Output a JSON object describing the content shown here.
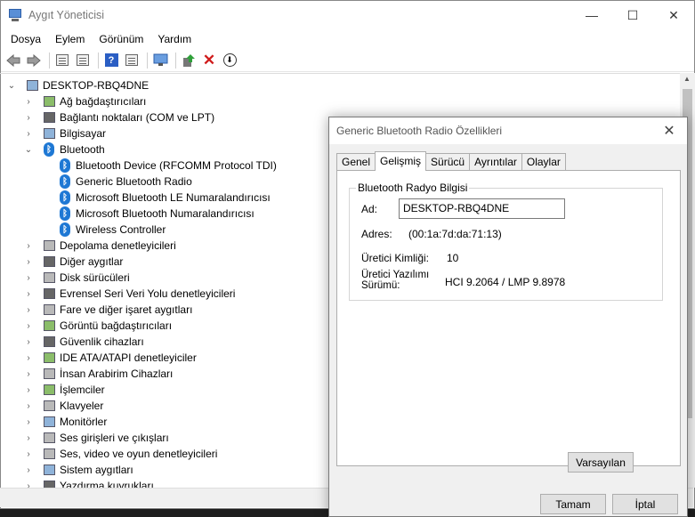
{
  "window": {
    "title": "Aygıt Yöneticisi",
    "controls": {
      "minimize": "—",
      "maximize": "☐",
      "close": "✕"
    }
  },
  "menu": [
    "Dosya",
    "Eylem",
    "Görünüm",
    "Yardım"
  ],
  "tree": {
    "root": "DESKTOP-RBQ4DNE",
    "categories_before": [
      {
        "label": "Ağ bağdaştırıcıları",
        "icon": "network-adapter-icon"
      },
      {
        "label": "Bağlantı noktaları (COM ve LPT)",
        "icon": "port-icon"
      },
      {
        "label": "Bilgisayar",
        "icon": "computer-icon"
      }
    ],
    "bluetooth": {
      "label": "Bluetooth",
      "children": [
        "Bluetooth Device (RFCOMM Protocol TDI)",
        "Generic Bluetooth Radio",
        "Microsoft Bluetooth LE Numaralandırıcısı",
        "Microsoft Bluetooth Numaralandırıcısı",
        "Wireless Controller"
      ]
    },
    "categories_after": [
      {
        "label": "Depolama denetleyicileri",
        "icon": "storage-controller-icon"
      },
      {
        "label": "Diğer aygıtlar",
        "icon": "other-devices-icon"
      },
      {
        "label": "Disk sürücüleri",
        "icon": "disk-drive-icon"
      },
      {
        "label": "Evrensel Seri Veri Yolu denetleyicileri",
        "icon": "usb-controller-icon"
      },
      {
        "label": "Fare ve diğer işaret aygıtları",
        "icon": "mouse-icon"
      },
      {
        "label": "Görüntü bağdaştırıcıları",
        "icon": "display-adapter-icon"
      },
      {
        "label": "Güvenlik cihazları",
        "icon": "security-device-icon"
      },
      {
        "label": "IDE ATA/ATAPI denetleyiciler",
        "icon": "ide-controller-icon"
      },
      {
        "label": "İnsan Arabirim Cihazları",
        "icon": "hid-icon"
      },
      {
        "label": "İşlemciler",
        "icon": "processor-icon"
      },
      {
        "label": "Klavyeler",
        "icon": "keyboard-icon"
      },
      {
        "label": "Monitörler",
        "icon": "monitor-icon"
      },
      {
        "label": "Ses girişleri ve çıkışları",
        "icon": "audio-io-icon"
      },
      {
        "label": "Ses, video ve oyun denetleyicileri",
        "icon": "sound-controller-icon"
      },
      {
        "label": "Sistem aygıtları",
        "icon": "system-devices-icon"
      },
      {
        "label": "Yazdırma kuyrukları",
        "icon": "print-queue-icon"
      }
    ]
  },
  "dialog": {
    "title": "Generic Bluetooth Radio Özellikleri",
    "tabs": [
      "Genel",
      "Gelişmiş",
      "Sürücü",
      "Ayrıntılar",
      "Olaylar"
    ],
    "active_tab": "Gelişmiş",
    "group_title": "Bluetooth Radyo Bilgisi",
    "name_label": "Ad:",
    "name_value": "DESKTOP-RBQ4DNE",
    "address_label": "Adres:",
    "address_value": "(00:1a:7d:da:71:13)",
    "manufacturer_label": "Üretici Kimliği:",
    "manufacturer_value": "10",
    "firmware_label_line1": "Üretici Yazılımı",
    "firmware_label_line2": "Sürümü:",
    "firmware_value": "HCI 9.2064  /  LMP 9.8978",
    "defaults_button": "Varsayılan",
    "ok_button": "Tamam",
    "cancel_button": "İptal"
  },
  "colors": {
    "bluetooth_blue": "#1e78d4",
    "delete_red": "#d01c1c"
  }
}
